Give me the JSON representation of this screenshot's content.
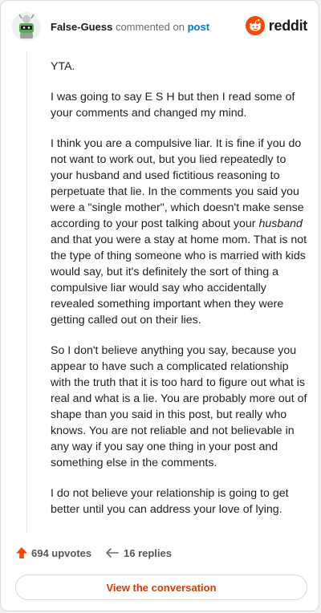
{
  "header": {
    "username": "False-Guess",
    "action": "commented on",
    "post_link": "post",
    "brand": "reddit",
    "brand_color": "#FF4500"
  },
  "comment": {
    "paragraphs": [
      "YTA.",
      "I was going to say E S H but then I read some of your comments and changed my mind.",
      {
        "before": "I think you are a compulsive liar. It is fine if you do not want to work out, but you lied repeatedly to your husband and used fictitious reasoning to perpetuate that lie. In the comments you said you were a \"single mother\", which doesn't make sense according to your post talking about your ",
        "italic": "husband",
        "after": " and that you were a stay at home mom. That is not the type of thing someone who is married with kids would say, but it's definitely the sort of thing a compulsive liar would say who accidentally revealed something important when they were getting called out on their lies."
      },
      "So I don't believe anything you say, because you appear to have such a complicated relationship with the truth that it is too hard to figure out what is real and what is a lie. You are probably more out of shape than you said in this post, but really who knows. You are not reliable and not believable in any way if you say one thing in your post and something else in the comments.",
      "I do not believe your relationship is going to get better until you can address your love of lying."
    ]
  },
  "footer": {
    "upvotes": "694 upvotes",
    "replies": "16 replies",
    "upvote_icon": "upvote-arrow-icon",
    "reply_icon": "reply-arrow-icon",
    "upvote_color": "#FF4500"
  },
  "cta": {
    "label": "View the conversation",
    "color": "#D93A00"
  }
}
